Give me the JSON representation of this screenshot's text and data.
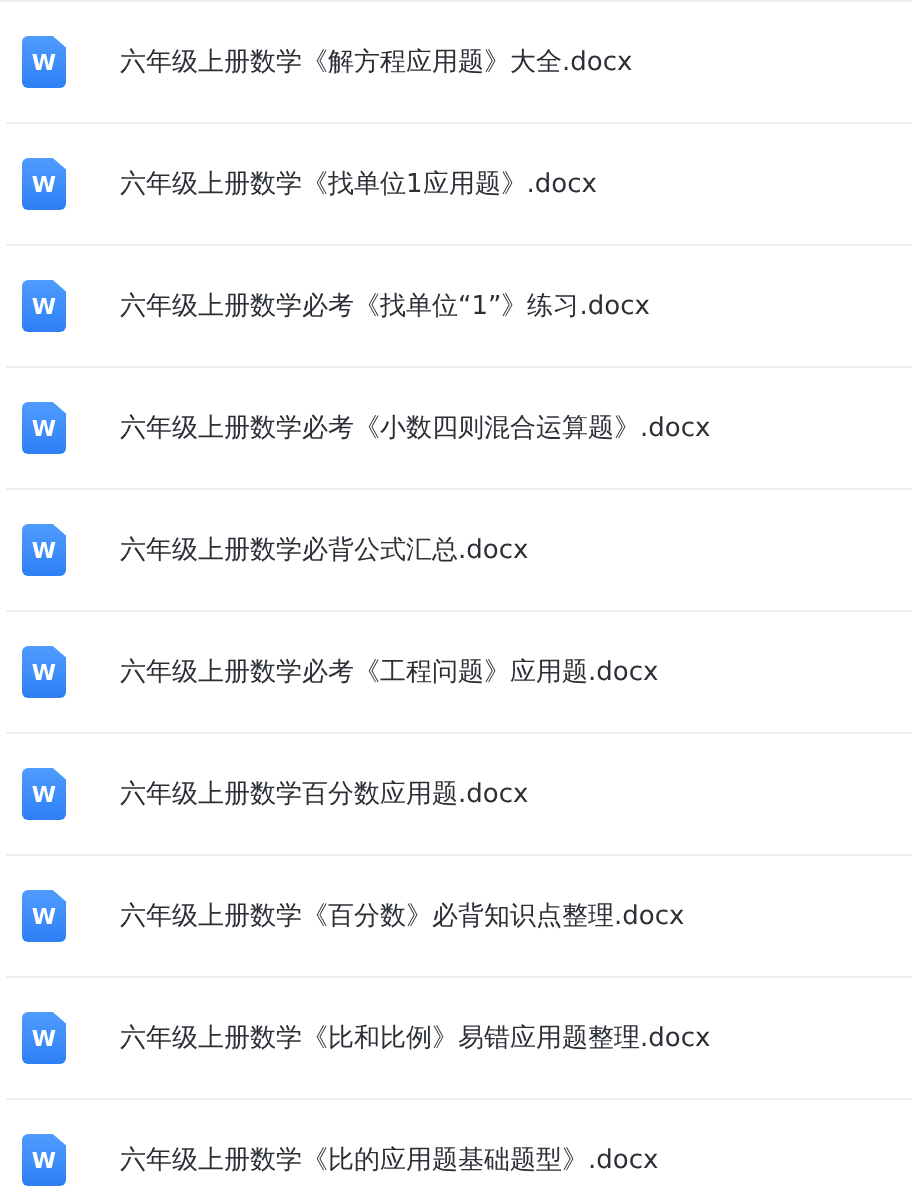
{
  "files": [
    {
      "name": "六年级上册数学《解方程应用题》大全.docx",
      "icon_text": "W"
    },
    {
      "name": "六年级上册数学《找单位1应用题》.docx",
      "icon_text": "W"
    },
    {
      "name": "六年级上册数学必考《找单位“1”》练习.docx",
      "icon_text": "W"
    },
    {
      "name": "六年级上册数学必考《小数四则混合运算题》.docx",
      "icon_text": "W"
    },
    {
      "name": "六年级上册数学必背公式汇总.docx",
      "icon_text": "W"
    },
    {
      "name": "六年级上册数学必考《工程问题》应用题.docx",
      "icon_text": "W"
    },
    {
      "name": "六年级上册数学百分数应用题.docx",
      "icon_text": "W"
    },
    {
      "name": "六年级上册数学《百分数》必背知识点整理.docx",
      "icon_text": "W"
    },
    {
      "name": "六年级上册数学《比和比例》易错应用题整理.docx",
      "icon_text": "W"
    },
    {
      "name": "六年级上册数学《比的应用题基础题型》.docx",
      "icon_text": "W"
    }
  ]
}
